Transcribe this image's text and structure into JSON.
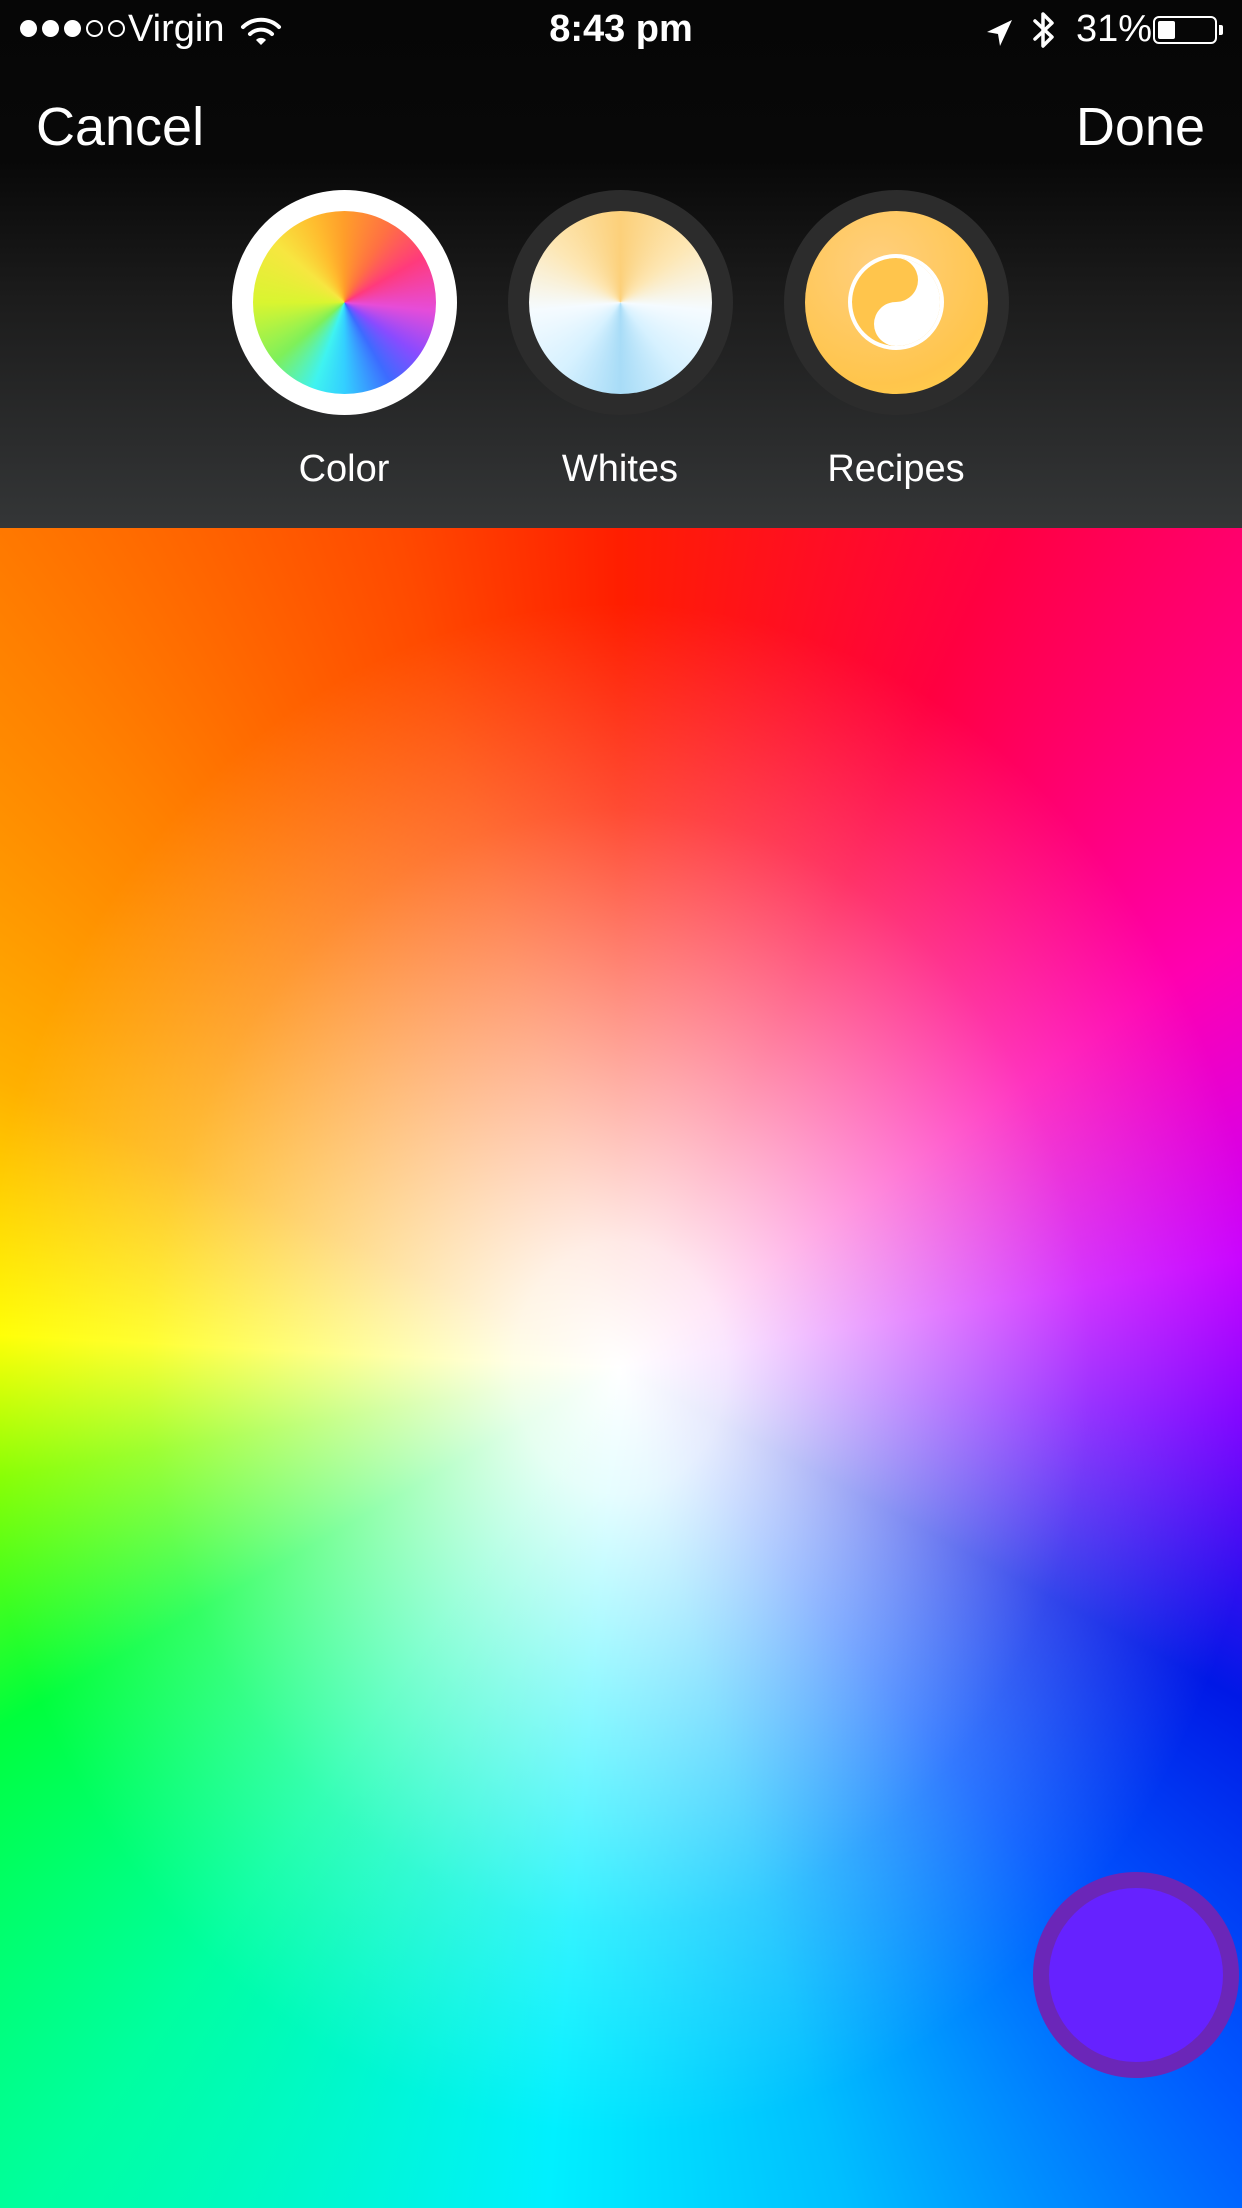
{
  "status_bar": {
    "signal_bars_filled": 3,
    "signal_bars_total": 5,
    "carrier": "Virgin",
    "time": "8:43 pm",
    "battery_percent": "31%",
    "battery_level": 0.31,
    "icons": [
      "wifi-icon",
      "location-arrow-icon",
      "bluetooth-icon",
      "battery-icon"
    ]
  },
  "nav": {
    "cancel_label": "Cancel",
    "done_label": "Done"
  },
  "modes": {
    "selected": "color",
    "color": {
      "label": "Color",
      "icon": "color-wheel-icon"
    },
    "whites": {
      "label": "Whites",
      "icon": "whites-wheel-icon"
    },
    "recipes": {
      "label": "Recipes",
      "icon": "recipes-icon"
    }
  },
  "picker": {
    "selected_color": "#6622ff",
    "selector_ring_color": "#6e28a0"
  },
  "colors": {
    "text": "#ffffff",
    "selected_ring": "#ffffff",
    "unselected_ring": "#2c2c2c"
  }
}
